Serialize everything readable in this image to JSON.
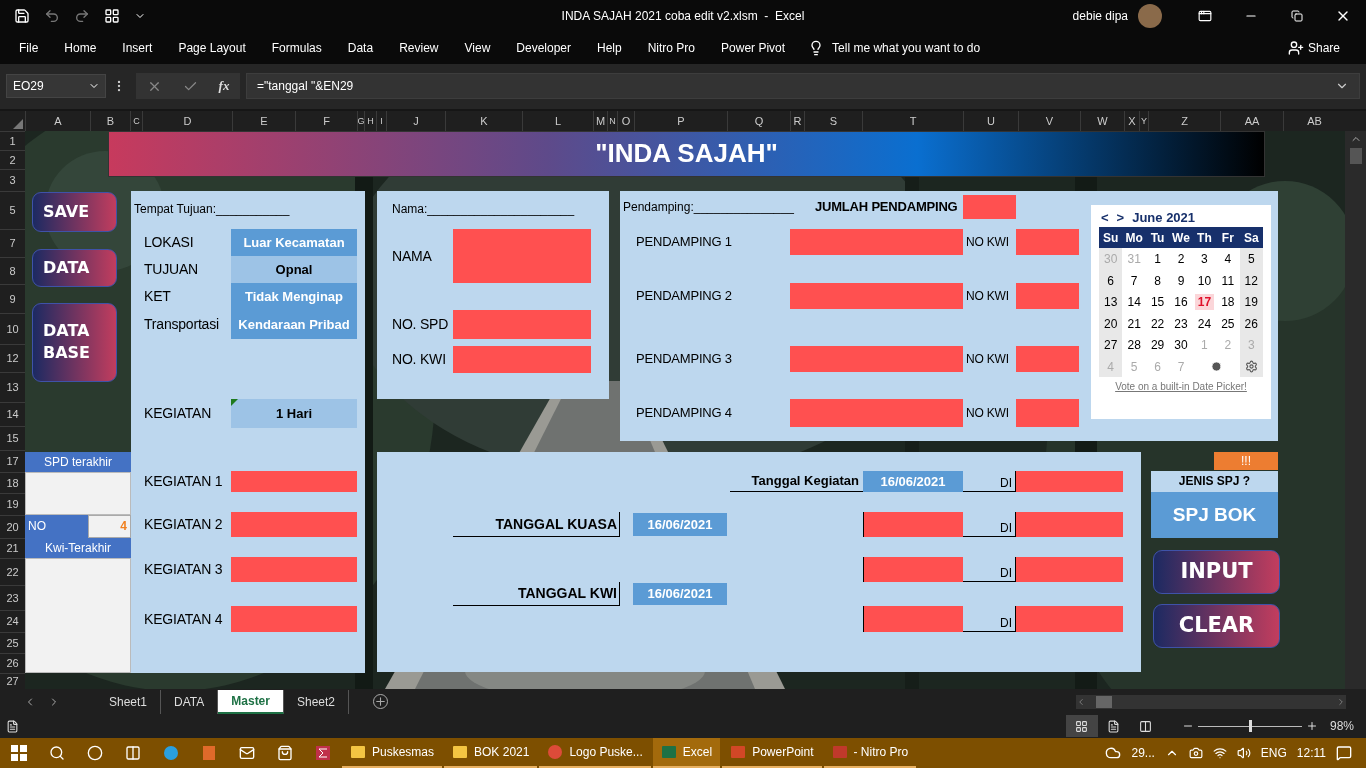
{
  "title_bar": {
    "title": "INDA SAJAH 2021 coba edit v2.xlsm  -  Excel",
    "user": "debie dipa"
  },
  "ribbon_tabs": [
    {
      "label": "File"
    },
    {
      "label": "Home"
    },
    {
      "label": "Insert"
    },
    {
      "label": "Page Layout"
    },
    {
      "label": "Formulas"
    },
    {
      "label": "Data"
    },
    {
      "label": "Review"
    },
    {
      "label": "View"
    },
    {
      "label": "Developer"
    },
    {
      "label": "Help"
    },
    {
      "label": "Nitro Pro"
    },
    {
      "label": "Power Pivot"
    }
  ],
  "tell_me": "Tell me what you want to do",
  "share": "Share",
  "formula_bar": {
    "name_box": "EO29",
    "function_label": "fx",
    "formula": "=\"tanggal \"&EN29"
  },
  "columns": [
    "A",
    "B",
    "C",
    "D",
    "E",
    "F",
    "G",
    "H",
    "I",
    "J",
    "K",
    "L",
    "M",
    "N",
    "O",
    "P",
    "Q",
    "R",
    "S",
    "T",
    "U",
    "V",
    "W",
    "X",
    "Y",
    "Z",
    "AA",
    "AB"
  ],
  "rows": [
    "1",
    "2",
    "3",
    "5",
    "7",
    "8",
    "9",
    "10",
    "12",
    "13",
    "14",
    "15",
    "17",
    "18",
    "19",
    "20",
    "21",
    "22",
    "23",
    "24",
    "25",
    "26",
    "27"
  ],
  "sheet": {
    "banner": "\"INDA SAJAH\"",
    "macro_buttons": [
      {
        "label": "SAVE"
      },
      {
        "label": "DATA"
      },
      {
        "label": "DATA BASE"
      }
    ],
    "last_records": {
      "spd_header": "SPD terakhir",
      "no_label": "NO",
      "no_value": "4",
      "kwi_header": "Kwi-Terakhir"
    },
    "trip_panel": {
      "heading": "Tempat Tujuan:___________",
      "fields": [
        {
          "label": "LOKASI",
          "value": "Luar Kecamatan",
          "kind": "accent"
        },
        {
          "label": "TUJUAN",
          "value": "Opnal",
          "kind": "pale"
        },
        {
          "label": "KET",
          "value": "Tidak Menginap",
          "kind": "accent"
        },
        {
          "label": "Transportasi",
          "value": "Kendaraan Pribad",
          "kind": "accent"
        }
      ],
      "duration": {
        "label": "KEGIATAN",
        "value": "1 Hari",
        "has_comment": true
      },
      "activities": [
        {
          "label": "KEGIATAN 1"
        },
        {
          "label": "KEGIATAN 2"
        },
        {
          "label": "KEGIATAN 3"
        },
        {
          "label": "KEGIATAN 4"
        }
      ]
    },
    "name_panel": {
      "heading": "Nama:______________________",
      "fields": [
        {
          "label": "NAMA"
        },
        {
          "label": "NO. SPD"
        },
        {
          "label": "NO. KWI"
        }
      ]
    },
    "companion_panel": {
      "heading": "Pendamping:_______________",
      "count_label": "JUMLAH PENDAMPING",
      "companions": [
        {
          "label": "PENDAMPING 1",
          "kwi_label": "NO KWI"
        },
        {
          "label": "PENDAMPING 2",
          "kwi_label": "NO KWI"
        },
        {
          "label": "PENDAMPING 3",
          "kwi_label": "NO KWI"
        },
        {
          "label": "PENDAMPING 4",
          "kwi_label": "NO KWI"
        }
      ]
    },
    "calendar": {
      "prev": "<",
      "next": ">",
      "month": "June 2021",
      "weekdays": [
        "Su",
        "Mo",
        "Tu",
        "We",
        "Th",
        "Fr",
        "Sa"
      ],
      "weeks": [
        [
          {
            "day": "30",
            "muted": true,
            "today": false
          },
          {
            "day": "31",
            "muted": true,
            "today": false
          },
          {
            "day": "1",
            "muted": false,
            "today": false
          },
          {
            "day": "2",
            "muted": false,
            "today": false
          },
          {
            "day": "3",
            "muted": false,
            "today": false
          },
          {
            "day": "4",
            "muted": false,
            "today": false
          },
          {
            "day": "5",
            "muted": false,
            "today": false
          }
        ],
        [
          {
            "day": "6",
            "muted": false,
            "today": false
          },
          {
            "day": "7",
            "muted": false,
            "today": false
          },
          {
            "day": "8",
            "muted": false,
            "today": false
          },
          {
            "day": "9",
            "muted": false,
            "today": false
          },
          {
            "day": "10",
            "muted": false,
            "today": false
          },
          {
            "day": "11",
            "muted": false,
            "today": false
          },
          {
            "day": "12",
            "muted": false,
            "today": false
          }
        ],
        [
          {
            "day": "13",
            "muted": false,
            "today": false
          },
          {
            "day": "14",
            "muted": false,
            "today": false
          },
          {
            "day": "15",
            "muted": false,
            "today": false
          },
          {
            "day": "16",
            "muted": false,
            "today": false
          },
          {
            "day": "17",
            "muted": false,
            "today": true
          },
          {
            "day": "18",
            "muted": false,
            "today": false
          },
          {
            "day": "19",
            "muted": false,
            "today": false
          }
        ],
        [
          {
            "day": "20",
            "muted": false,
            "today": false
          },
          {
            "day": "21",
            "muted": false,
            "today": false
          },
          {
            "day": "22",
            "muted": false,
            "today": false
          },
          {
            "day": "23",
            "muted": false,
            "today": false
          },
          {
            "day": "24",
            "muted": false,
            "today": false
          },
          {
            "day": "25",
            "muted": false,
            "today": false
          },
          {
            "day": "26",
            "muted": false,
            "today": false
          }
        ],
        [
          {
            "day": "27",
            "muted": false,
            "today": false
          },
          {
            "day": "28",
            "muted": false,
            "today": false
          },
          {
            "day": "29",
            "muted": false,
            "today": false
          },
          {
            "day": "30",
            "muted": false,
            "today": false
          },
          {
            "day": "1",
            "muted": true,
            "today": false
          },
          {
            "day": "2",
            "muted": true,
            "today": false
          },
          {
            "day": "3",
            "muted": true,
            "today": false
          }
        ],
        [
          {
            "day": "4",
            "muted": true,
            "today": false
          },
          {
            "day": "5",
            "muted": true,
            "today": false
          },
          {
            "day": "6",
            "muted": true,
            "today": false
          },
          {
            "day": "7",
            "muted": true,
            "today": false
          }
        ]
      ],
      "link": "Vote on a built-in Date Picker!"
    },
    "dates_panel": {
      "activity_date_label": "Tanggal Kegiatan",
      "activity_date": "16/06/2021",
      "di_labels": [
        "DI",
        "DI",
        "DI",
        "DI"
      ],
      "proxy_date_label": "TANGGAL KUASA",
      "proxy_date": "16/06/2021",
      "receipt_date_label": "TANGGAL KWI",
      "receipt_date": "16/06/2021"
    },
    "spj": {
      "alert": "!!!",
      "question": "JENIS SPJ ?",
      "value": "SPJ BOK"
    },
    "action_buttons": [
      {
        "label": "INPUT"
      },
      {
        "label": "CLEAR"
      }
    ]
  },
  "sheet_tabs": [
    {
      "label": "Sheet1",
      "selected": false
    },
    {
      "label": "DATA",
      "selected": false
    },
    {
      "label": "Master",
      "selected": true
    },
    {
      "label": "Sheet2",
      "selected": false
    }
  ],
  "status_bar": {
    "view_buttons": [
      {
        "kind": "normal",
        "selected": true
      },
      {
        "kind": "page_layout",
        "selected": false
      },
      {
        "kind": "page_break",
        "selected": false
      }
    ],
    "zoom": {
      "level": 0.5,
      "reading": "98%"
    }
  },
  "taskbar": {
    "items": [
      {
        "label": "Puskesmas",
        "kind": "folder",
        "selected": false
      },
      {
        "label": "BOK 2021",
        "kind": "folder",
        "selected": false
      },
      {
        "label": "Logo Puske...",
        "kind": "browser",
        "selected": false
      },
      {
        "label": "Excel",
        "kind": "excel",
        "selected": true
      },
      {
        "label": "PowerPoint",
        "kind": "powerpoint",
        "selected": false
      },
      {
        "label": "- Nitro Pro",
        "kind": "pdf",
        "selected": false
      }
    ],
    "weather": "29...",
    "language": "ENG",
    "time": "12:11"
  }
}
